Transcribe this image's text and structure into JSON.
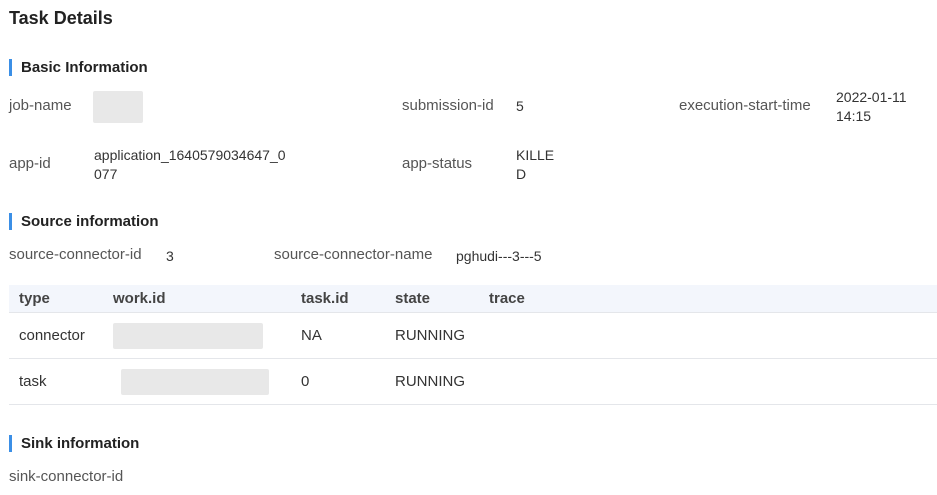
{
  "page": {
    "title": "Task Details"
  },
  "basic": {
    "title": "Basic Information",
    "job_name_label": "job-name",
    "submission_id_label": "submission-id",
    "submission_id": "5",
    "exec_start_label": "execution-start-time",
    "exec_start_line1": "2022-01-11",
    "exec_start_line2": "14:15",
    "app_id_label": "app-id",
    "app_id_line1": "application_1640579034647_0",
    "app_id_line2": "077",
    "app_status_label": "app-status",
    "app_status_line1": "KILLE",
    "app_status_line2": "D"
  },
  "source": {
    "title": "Source information",
    "connector_id_label": "source-connector-id",
    "connector_id": "3",
    "connector_name_label": "source-connector-name",
    "connector_name": "pghudi---3---5"
  },
  "table": {
    "headers": [
      "type",
      "work.id",
      "task.id",
      "state",
      "trace"
    ],
    "rows": [
      {
        "type": "connector",
        "task_id": "NA",
        "state": "RUNNING",
        "trace": ""
      },
      {
        "type": "task",
        "task_id": "0",
        "state": "RUNNING",
        "trace": ""
      }
    ]
  },
  "sink": {
    "title": "Sink information",
    "connector_id_label": "sink-connector-id"
  }
}
